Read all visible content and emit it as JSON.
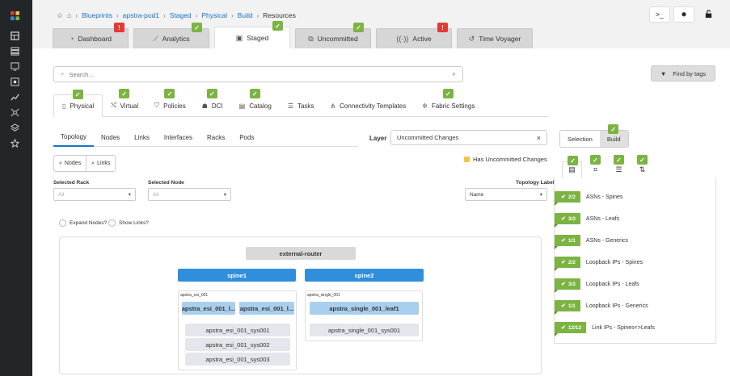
{
  "breadcrumb": [
    "Blueprints",
    "apstra-pod1",
    "Staged",
    "Physical",
    "Build"
  ],
  "breadcrumb_current": "Resources",
  "topbar": {
    "cli_icon": ">_",
    "bug_icon": "bug-icon",
    "lock_icon": "lock-icon"
  },
  "main_tabs": [
    {
      "label": "Dashboard",
      "icon": "dashboard-icon",
      "badge": "!",
      "badge_color": "#e53935"
    },
    {
      "label": "Analytics",
      "icon": "chart-icon",
      "badge": "✓",
      "badge_color": "#7cb342"
    },
    {
      "label": "Staged",
      "icon": "staged-icon",
      "badge": "✓",
      "badge_color": "#7cb342"
    },
    {
      "label": "Uncommitted",
      "icon": "uncommitted-icon",
      "badge": "✓",
      "badge_color": "#7cb342"
    },
    {
      "label": "Active",
      "icon": "active-icon",
      "badge": "!",
      "badge_color": "#e53935"
    },
    {
      "label": "Time Voyager",
      "icon": "history-icon",
      "badge": "",
      "badge_color": ""
    }
  ],
  "search": {
    "placeholder": "Search...",
    "value": ""
  },
  "find_by_tags": "Find by tags",
  "sub_tabs": [
    {
      "label": "Physical",
      "icon": "▯"
    },
    {
      "label": "Virtual",
      "icon": "⤭"
    },
    {
      "label": "Policies",
      "icon": "⛉"
    },
    {
      "label": "DCI",
      "icon": "☗"
    },
    {
      "label": "Catalog",
      "icon": "▤"
    },
    {
      "label": "Tasks",
      "icon": "☰"
    },
    {
      "label": "Connectivity Templates",
      "icon": "⋔"
    },
    {
      "label": "Fabric Settings",
      "icon": "✲"
    }
  ],
  "topology_tabs": [
    "Topology",
    "Nodes",
    "Links",
    "Interfaces",
    "Racks",
    "Pods"
  ],
  "layer": {
    "label": "Layer",
    "value": "Uncommitted Changes"
  },
  "uncommitted_legend": "Has Uncommitted Changes",
  "uncommitted_color": "#f6c342",
  "view_buttons": {
    "nodes": "Nodes",
    "links": "Links"
  },
  "filters": {
    "rack_label": "Selected Rack",
    "rack_value": "All",
    "node_label": "Selected Node",
    "node_value": "All",
    "topo_label": "Topology Label",
    "topo_value": "Name"
  },
  "checkboxes": {
    "expand": "Expand Nodes?",
    "show_links": "Show Links?"
  },
  "topology": {
    "external": "external-router",
    "spines": [
      "spine1",
      "spine2"
    ],
    "racks": [
      {
        "name": "apstra_esi_001",
        "leafs": [
          "apstra_esi_001_l...",
          "apstra_esi_001_l..."
        ],
        "systems": [
          "apstra_esi_001_sys001",
          "apstra_esi_001_sys002",
          "apstra_esi_001_sys003"
        ]
      },
      {
        "name": "apstra_single_001",
        "leafs": [
          "apstra_single_001_leaf1"
        ],
        "systems": [
          "apstra_single_001_sys001"
        ]
      }
    ]
  },
  "right_tabs": [
    "Selection",
    "Build"
  ],
  "resources": [
    {
      "count": "2/2",
      "label": "ASNs - Spines"
    },
    {
      "count": "3/3",
      "label": "ASNs - Leafs"
    },
    {
      "count": "1/1",
      "label": "ASNs - Generics"
    },
    {
      "count": "2/2",
      "label": "Loopback IPs - Spines"
    },
    {
      "count": "3/3",
      "label": "Loopback IPs - Leafs"
    },
    {
      "count": "1/1",
      "label": "Loopback IPs - Generics"
    },
    {
      "count": "12/12",
      "label": "Link IPs - Spines<>Leafs"
    }
  ],
  "colors": {
    "accent": "#1a73c9",
    "ok": "#7cb342",
    "error": "#e53935",
    "spine": "#2f8fdc",
    "leaf": "#a9cfee"
  }
}
